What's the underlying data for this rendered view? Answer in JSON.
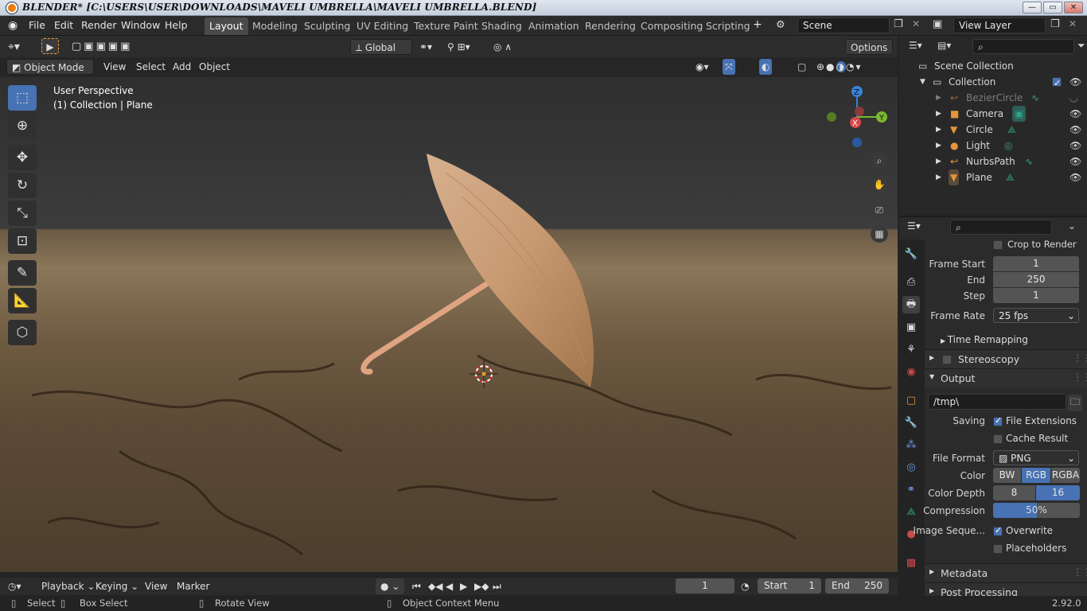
{
  "window": {
    "title": "BLENDER* [C:\\USERS\\USER\\DOWNLOADS\\MAVELI UMBRELLA\\MAVELI UMBRELLA.BLEND]"
  },
  "menu": [
    "File",
    "Edit",
    "Render",
    "Window",
    "Help"
  ],
  "workspaces": [
    "Layout",
    "Modeling",
    "Sculpting",
    "UV Editing",
    "Texture Paint",
    "Shading",
    "Animation",
    "Rendering",
    "Compositing",
    "Scripting"
  ],
  "scene": {
    "name": "Scene",
    "view_layer": "View Layer"
  },
  "viewport_header": {
    "transform": "Global",
    "options": "Options"
  },
  "mode_header": {
    "mode": "Object Mode",
    "items": [
      "View",
      "Select",
      "Add",
      "Object"
    ]
  },
  "overlay_text": {
    "line1": "User Perspective",
    "line2": "(1) Collection | Plane"
  },
  "gizmo": {
    "x": "X",
    "y": "Y",
    "z": "Z"
  },
  "outliner": {
    "root": "Scene Collection",
    "collection": "Collection",
    "items": [
      {
        "name": "BezierCircle",
        "disabled": true
      },
      {
        "name": "Camera"
      },
      {
        "name": "Circle"
      },
      {
        "name": "Light"
      },
      {
        "name": "NurbsPath"
      },
      {
        "name": "Plane"
      }
    ]
  },
  "properties": {
    "crop": "Crop to Render ...",
    "frame_start_label": "Frame Start",
    "frame_start": "1",
    "end_label": "End",
    "end": "250",
    "step_label": "Step",
    "step": "1",
    "frame_rate_label": "Frame Rate",
    "frame_rate": "25 fps",
    "time_remapping": "Time Remapping",
    "stereoscopy": "Stereoscopy",
    "output": "Output",
    "path": "/tmp\\",
    "saving_label": "Saving",
    "file_extensions": "File Extensions",
    "cache_result": "Cache Result",
    "file_format_label": "File Format",
    "file_format": "PNG",
    "color_label": "Color",
    "color_opts": [
      "BW",
      "RGB",
      "RGBA"
    ],
    "color_depth_label": "Color Depth",
    "depth_opts": [
      "8",
      "16"
    ],
    "compression_label": "Compression",
    "compression": "50%",
    "compression_value": 0.5,
    "image_seq_label": "Image Seque...",
    "overwrite": "Overwrite",
    "placeholders": "Placeholders",
    "metadata": "Metadata",
    "post_processing": "Post Processing"
  },
  "timeline": {
    "items": [
      "Playback",
      "Keying",
      "View",
      "Marker"
    ],
    "current_frame": "1",
    "start_label": "Start",
    "start": "1",
    "end_label": "End",
    "end": "250"
  },
  "status": {
    "select": "Select",
    "box_select": "Box Select",
    "rotate_view": "Rotate View",
    "context_menu": "Object Context Menu",
    "version": "2.92.0"
  }
}
